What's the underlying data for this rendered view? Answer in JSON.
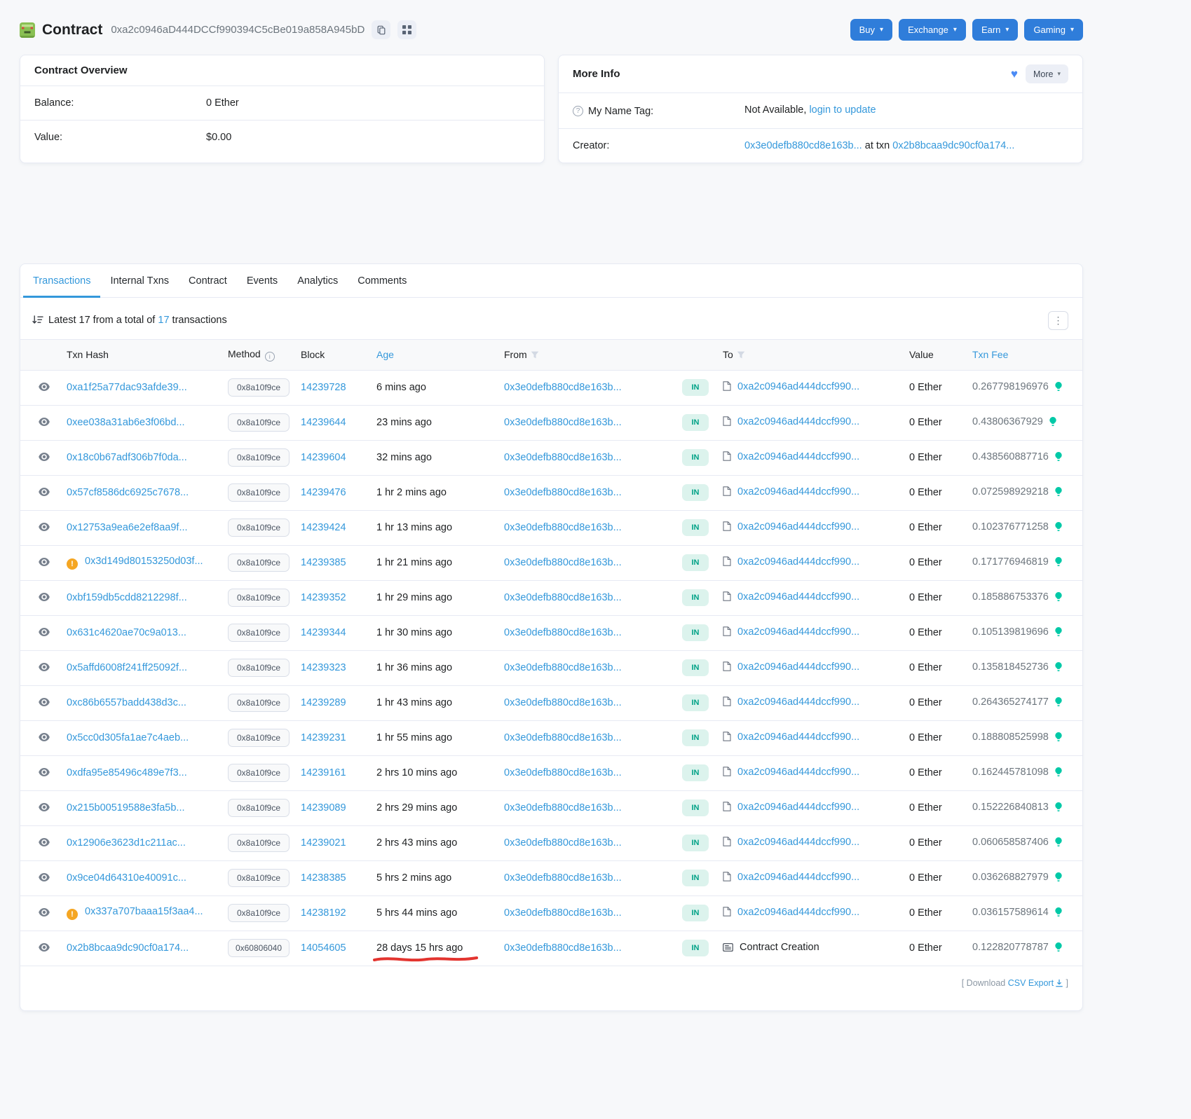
{
  "colors": {
    "link_blue": "#3498db",
    "button_blue": "#2f7dda",
    "in_badge_bg": "#dcf3ed",
    "in_badge_text": "#00a186",
    "warning_orange": "#f5a623",
    "gas_bulb_green": "#00c9a7",
    "annotation_red": "#e3342f"
  },
  "icons": {
    "caret": "▾",
    "heart": "♥",
    "kebab": "⋮",
    "info": "i",
    "question": "?",
    "warning": "!"
  },
  "header": {
    "title": "Contract",
    "address": "0xa2c0946aD444DCCf990394C5cBe019a858A945bD",
    "actions": [
      {
        "label": "Buy",
        "name": "nav-buy-button"
      },
      {
        "label": "Exchange",
        "name": "nav-exchange-button"
      },
      {
        "label": "Earn",
        "name": "nav-earn-button"
      },
      {
        "label": "Gaming",
        "name": "nav-gaming-button"
      }
    ]
  },
  "overview_card": {
    "title": "Contract Overview",
    "balance_label": "Balance:",
    "balance_value": "0 Ether",
    "value_label": "Value:",
    "value_value": "$0.00"
  },
  "more_info_card": {
    "title": "More Info",
    "more_button": "More",
    "name_tag_label": "My Name Tag:",
    "name_tag_value": "Not Available,",
    "name_tag_link": "login to update",
    "creator_label": "Creator:",
    "creator_link": "0x3e0defb880cd8e163b...",
    "creator_mid": "at txn",
    "creator_txn_link": "0x2b8bcaa9dc90cf0a174..."
  },
  "tabs": [
    {
      "label": "Transactions",
      "name": "tab-transactions"
    },
    {
      "label": "Internal Txns",
      "name": "tab-internal-txns"
    },
    {
      "label": "Contract",
      "name": "tab-contract"
    },
    {
      "label": "Events",
      "name": "tab-events"
    },
    {
      "label": "Analytics",
      "name": "tab-analytics"
    },
    {
      "label": "Comments",
      "name": "tab-comments"
    }
  ],
  "table": {
    "summary_prefix": "Latest 17 from a total of ",
    "summary_count": "17",
    "summary_suffix": " transactions",
    "columns": {
      "hash": "Txn Hash",
      "method": "Method",
      "block": "Block",
      "age": "Age",
      "from": "From",
      "to": "To",
      "value": "Value",
      "fee": "Txn Fee"
    },
    "rows": [
      {
        "hash": "0xa1f25a77dac93afde39...",
        "method": "0x8a10f9ce",
        "block": "14239728",
        "age": "6 mins ago",
        "from": "0x3e0defb880cd8e163b...",
        "dir": "IN",
        "to": "0xa2c0946ad444dccf990...",
        "value": "0 Ether",
        "fee": "0.267798196976",
        "to_doc": true
      },
      {
        "hash": "0xee038a31ab6e3f06bd...",
        "method": "0x8a10f9ce",
        "block": "14239644",
        "age": "23 mins ago",
        "from": "0x3e0defb880cd8e163b...",
        "dir": "IN",
        "to": "0xa2c0946ad444dccf990...",
        "value": "0 Ether",
        "fee": "0.43806367929",
        "to_doc": true
      },
      {
        "hash": "0x18c0b67adf306b7f0da...",
        "method": "0x8a10f9ce",
        "block": "14239604",
        "age": "32 mins ago",
        "from": "0x3e0defb880cd8e163b...",
        "dir": "IN",
        "to": "0xa2c0946ad444dccf990...",
        "value": "0 Ether",
        "fee": "0.438560887716",
        "to_doc": true
      },
      {
        "hash": "0x57cf8586dc6925c7678...",
        "method": "0x8a10f9ce",
        "block": "14239476",
        "age": "1 hr 2 mins ago",
        "from": "0x3e0defb880cd8e163b...",
        "dir": "IN",
        "to": "0xa2c0946ad444dccf990...",
        "value": "0 Ether",
        "fee": "0.072598929218",
        "to_doc": true
      },
      {
        "hash": "0x12753a9ea6e2ef8aa9f...",
        "method": "0x8a10f9ce",
        "block": "14239424",
        "age": "1 hr 13 mins ago",
        "from": "0x3e0defb880cd8e163b...",
        "dir": "IN",
        "to": "0xa2c0946ad444dccf990...",
        "value": "0 Ether",
        "fee": "0.102376771258",
        "to_doc": true
      },
      {
        "hash": "0x3d149d80153250d03f...",
        "warning": true,
        "method": "0x8a10f9ce",
        "block": "14239385",
        "age": "1 hr 21 mins ago",
        "from": "0x3e0defb880cd8e163b...",
        "dir": "IN",
        "to": "0xa2c0946ad444dccf990...",
        "value": "0 Ether",
        "fee": "0.171776946819",
        "to_doc": true
      },
      {
        "hash": "0xbf159db5cdd8212298f...",
        "method": "0x8a10f9ce",
        "block": "14239352",
        "age": "1 hr 29 mins ago",
        "from": "0x3e0defb880cd8e163b...",
        "dir": "IN",
        "to": "0xa2c0946ad444dccf990...",
        "value": "0 Ether",
        "fee": "0.185886753376",
        "to_doc": true
      },
      {
        "hash": "0x631c4620ae70c9a013...",
        "method": "0x8a10f9ce",
        "block": "14239344",
        "age": "1 hr 30 mins ago",
        "from": "0x3e0defb880cd8e163b...",
        "dir": "IN",
        "to": "0xa2c0946ad444dccf990...",
        "value": "0 Ether",
        "fee": "0.105139819696",
        "to_doc": true
      },
      {
        "hash": "0x5affd6008f241ff25092f...",
        "method": "0x8a10f9ce",
        "block": "14239323",
        "age": "1 hr 36 mins ago",
        "from": "0x3e0defb880cd8e163b...",
        "dir": "IN",
        "to": "0xa2c0946ad444dccf990...",
        "value": "0 Ether",
        "fee": "0.135818452736",
        "to_doc": true
      },
      {
        "hash": "0xc86b6557badd438d3c...",
        "method": "0x8a10f9ce",
        "block": "14239289",
        "age": "1 hr 43 mins ago",
        "from": "0x3e0defb880cd8e163b...",
        "dir": "IN",
        "to": "0xa2c0946ad444dccf990...",
        "value": "0 Ether",
        "fee": "0.264365274177",
        "to_doc": true
      },
      {
        "hash": "0x5cc0d305fa1ae7c4aeb...",
        "method": "0x8a10f9ce",
        "block": "14239231",
        "age": "1 hr 55 mins ago",
        "from": "0x3e0defb880cd8e163b...",
        "dir": "IN",
        "to": "0xa2c0946ad444dccf990...",
        "value": "0 Ether",
        "fee": "0.188808525998",
        "to_doc": true
      },
      {
        "hash": "0xdfa95e85496c489e7f3...",
        "method": "0x8a10f9ce",
        "block": "14239161",
        "age": "2 hrs 10 mins ago",
        "from": "0x3e0defb880cd8e163b...",
        "dir": "IN",
        "to": "0xa2c0946ad444dccf990...",
        "value": "0 Ether",
        "fee": "0.162445781098",
        "to_doc": true
      },
      {
        "hash": "0x215b00519588e3fa5b...",
        "method": "0x8a10f9ce",
        "block": "14239089",
        "age": "2 hrs 29 mins ago",
        "from": "0x3e0defb880cd8e163b...",
        "dir": "IN",
        "to": "0xa2c0946ad444dccf990...",
        "value": "0 Ether",
        "fee": "0.152226840813",
        "to_doc": true
      },
      {
        "hash": "0x12906e3623d1c211ac...",
        "method": "0x8a10f9ce",
        "block": "14239021",
        "age": "2 hrs 43 mins ago",
        "from": "0x3e0defb880cd8e163b...",
        "dir": "IN",
        "to": "0xa2c0946ad444dccf990...",
        "value": "0 Ether",
        "fee": "0.060658587406",
        "to_doc": true
      },
      {
        "hash": "0x9ce04d64310e40091c...",
        "method": "0x8a10f9ce",
        "block": "14238385",
        "age": "5 hrs 2 mins ago",
        "from": "0x3e0defb880cd8e163b...",
        "dir": "IN",
        "to": "0xa2c0946ad444dccf990...",
        "value": "0 Ether",
        "fee": "0.036268827979",
        "to_doc": true
      },
      {
        "hash": "0x337a707baaa15f3aa4...",
        "warning": true,
        "method": "0x8a10f9ce",
        "block": "14238192",
        "age": "5 hrs 44 mins ago",
        "from": "0x3e0defb880cd8e163b...",
        "dir": "IN",
        "to": "0xa2c0946ad444dccf990...",
        "value": "0 Ether",
        "fee": "0.036157589614",
        "to_doc": true
      },
      {
        "hash": "0x2b8bcaa9dc90cf0a174...",
        "method": "0x60806040",
        "block": "14054605",
        "age": "28 days 15 hrs ago",
        "from": "0x3e0defb880cd8e163b...",
        "dir": "IN",
        "to": "Contract Creation",
        "value": "0 Ether",
        "fee": "0.122820778787",
        "creation": true,
        "annotate": true
      }
    ],
    "csv_prefix": "[ Download ",
    "csv_link": "CSV Export",
    "csv_suffix": " ]"
  }
}
